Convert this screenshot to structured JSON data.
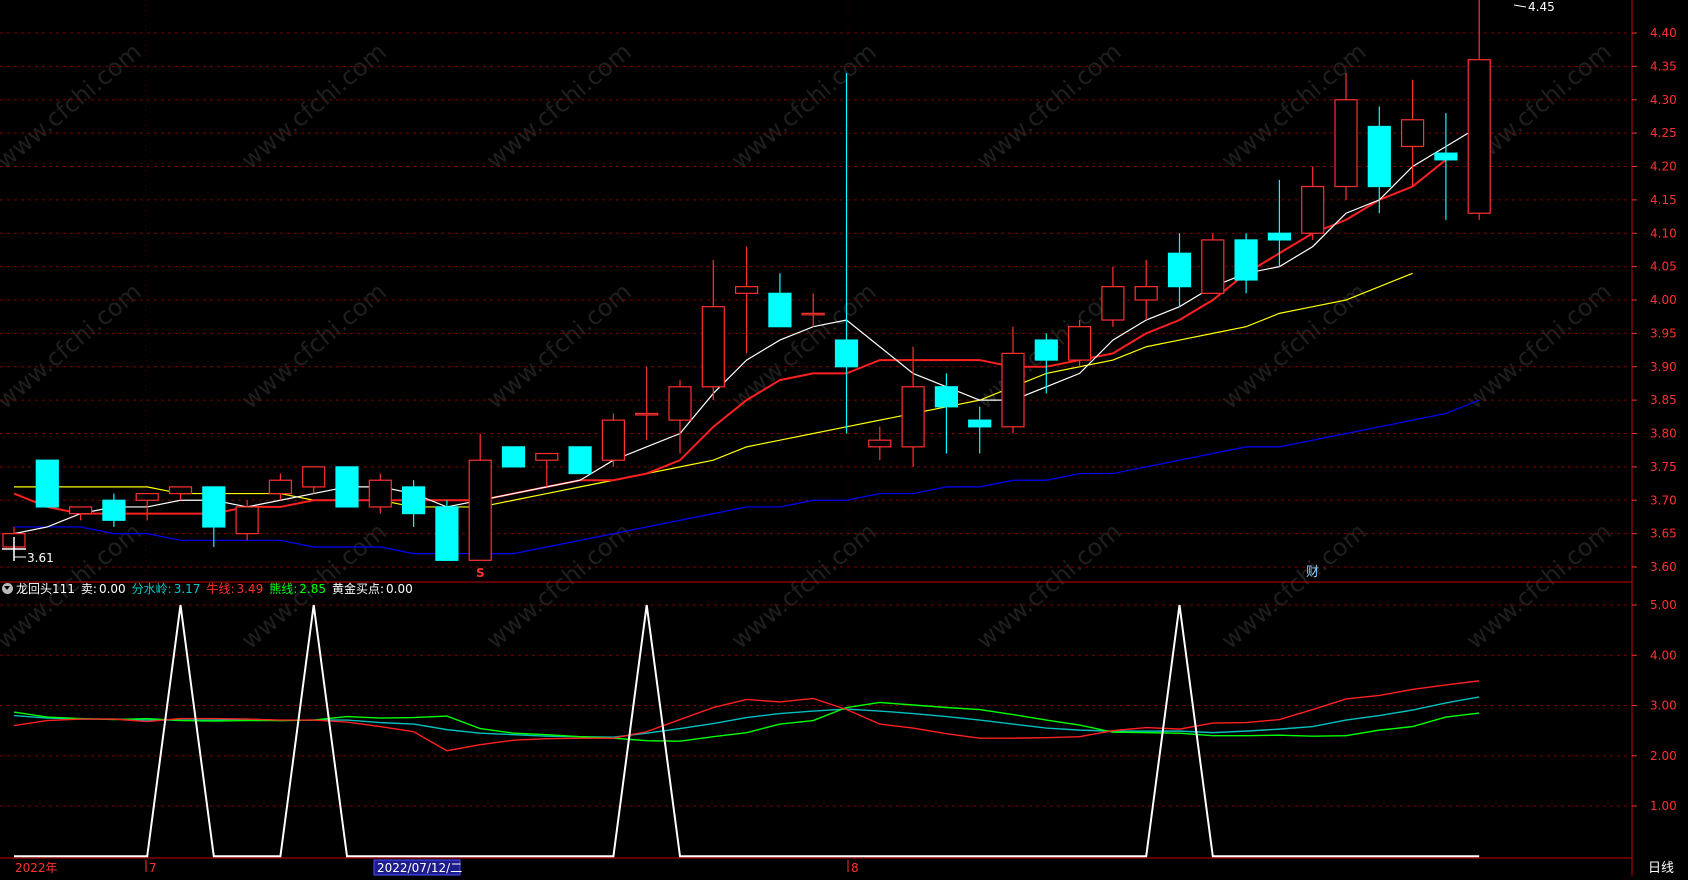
{
  "colors": {
    "background": "#000000",
    "grid": "#7a0000",
    "axis_text": "#ff3030",
    "candle_up": "#ff3030",
    "candle_down": "#00ffff",
    "ma5": "#ffffff",
    "ma10": "#ff2020",
    "ma20": "#ffff00",
    "ma60": "#0000ff",
    "ind_fenshuiling": "#00c0c0",
    "ind_niuxian": "#ff2020",
    "ind_xiongxian": "#00ff00",
    "ind_mai": "#ffffff"
  },
  "top_labels": {
    "high_label": "4.45",
    "low_label": "3.61",
    "marker_s": "S",
    "marker_cai": "财"
  },
  "indicator": {
    "collapse_icon": "chevron-down-icon",
    "name": "龙回头111",
    "mai_label": "卖:",
    "mai_value": "0.00",
    "fenshuiling_label": "分水岭:",
    "fenshuiling_value": "3.17",
    "niuxian_label": "牛线:",
    "niuxian_value": "3.49",
    "xiongxian_label": "熊线:",
    "xiongxian_value": "2.85",
    "huangjin_label": "黄金买点:",
    "huangjin_value": "0.00"
  },
  "bottom_bar": {
    "year": "2022年",
    "month1": "7",
    "cursor_date": "2022/07/12/二",
    "month2": "8",
    "period": "日线"
  },
  "watermark_text": "www.cfchi.com",
  "chart_data": [
    {
      "type": "candlestick",
      "title": "",
      "y_ticks": [
        3.6,
        3.65,
        3.7,
        3.75,
        3.8,
        3.85,
        3.9,
        3.95,
        4.0,
        4.05,
        4.1,
        4.15,
        4.2,
        4.25,
        4.3,
        4.35,
        4.4,
        4.45
      ],
      "ylim": [
        3.585,
        4.455
      ],
      "grid": true,
      "candles": [
        {
          "o": 3.63,
          "h": 3.66,
          "l": 3.62,
          "c": 3.65
        },
        {
          "o": 3.76,
          "h": 3.76,
          "l": 3.69,
          "c": 3.69
        },
        {
          "o": 3.68,
          "h": 3.69,
          "l": 3.67,
          "c": 3.69
        },
        {
          "o": 3.7,
          "h": 3.71,
          "l": 3.66,
          "c": 3.67
        },
        {
          "o": 3.7,
          "h": 3.71,
          "l": 3.67,
          "c": 3.71
        },
        {
          "o": 3.71,
          "h": 3.72,
          "l": 3.7,
          "c": 3.72
        },
        {
          "o": 3.72,
          "h": 3.72,
          "l": 3.63,
          "c": 3.66
        },
        {
          "o": 3.65,
          "h": 3.7,
          "l": 3.64,
          "c": 3.69
        },
        {
          "o": 3.71,
          "h": 3.74,
          "l": 3.7,
          "c": 3.73
        },
        {
          "o": 3.72,
          "h": 3.75,
          "l": 3.71,
          "c": 3.75
        },
        {
          "o": 3.75,
          "h": 3.75,
          "l": 3.69,
          "c": 3.69
        },
        {
          "o": 3.69,
          "h": 3.74,
          "l": 3.68,
          "c": 3.73
        },
        {
          "o": 3.72,
          "h": 3.73,
          "l": 3.66,
          "c": 3.68
        },
        {
          "o": 3.69,
          "h": 3.7,
          "l": 3.61,
          "c": 3.61
        },
        {
          "o": 3.61,
          "h": 3.8,
          "l": 3.61,
          "c": 3.76
        },
        {
          "o": 3.78,
          "h": 3.78,
          "l": 3.75,
          "c": 3.75
        },
        {
          "o": 3.76,
          "h": 3.77,
          "l": 3.72,
          "c": 3.77
        },
        {
          "o": 3.78,
          "h": 3.78,
          "l": 3.74,
          "c": 3.74
        },
        {
          "o": 3.76,
          "h": 3.83,
          "l": 3.75,
          "c": 3.82
        },
        {
          "o": 3.83,
          "h": 3.9,
          "l": 3.79,
          "c": 3.83
        },
        {
          "o": 3.82,
          "h": 3.88,
          "l": 3.77,
          "c": 3.87
        },
        {
          "o": 3.87,
          "h": 4.06,
          "l": 3.85,
          "c": 3.99
        },
        {
          "o": 4.01,
          "h": 4.08,
          "l": 3.92,
          "c": 4.02
        },
        {
          "o": 4.01,
          "h": 4.04,
          "l": 3.96,
          "c": 3.96
        },
        {
          "o": 3.98,
          "h": 4.01,
          "l": 3.96,
          "c": 3.98
        },
        {
          "o": 3.94,
          "h": 4.34,
          "l": 3.8,
          "c": 3.9
        },
        {
          "o": 3.78,
          "h": 3.81,
          "l": 3.76,
          "c": 3.79
        },
        {
          "o": 3.78,
          "h": 3.93,
          "l": 3.75,
          "c": 3.87
        },
        {
          "o": 3.87,
          "h": 3.89,
          "l": 3.77,
          "c": 3.84
        },
        {
          "o": 3.82,
          "h": 3.84,
          "l": 3.77,
          "c": 3.81
        },
        {
          "o": 3.81,
          "h": 3.96,
          "l": 3.8,
          "c": 3.92
        },
        {
          "o": 3.94,
          "h": 3.95,
          "l": 3.86,
          "c": 3.91
        },
        {
          "o": 3.91,
          "h": 3.97,
          "l": 3.9,
          "c": 3.96
        },
        {
          "o": 3.97,
          "h": 4.05,
          "l": 3.96,
          "c": 4.02
        },
        {
          "o": 4.0,
          "h": 4.06,
          "l": 3.97,
          "c": 4.02
        },
        {
          "o": 4.07,
          "h": 4.1,
          "l": 3.99,
          "c": 4.02
        },
        {
          "o": 4.01,
          "h": 4.1,
          "l": 4.01,
          "c": 4.09
        },
        {
          "o": 4.09,
          "h": 4.1,
          "l": 4.01,
          "c": 4.03
        },
        {
          "o": 4.1,
          "h": 4.18,
          "l": 4.05,
          "c": 4.09
        },
        {
          "o": 4.1,
          "h": 4.2,
          "l": 4.09,
          "c": 4.17
        },
        {
          "o": 4.17,
          "h": 4.34,
          "l": 4.15,
          "c": 4.3
        },
        {
          "o": 4.26,
          "h": 4.29,
          "l": 4.13,
          "c": 4.17
        },
        {
          "o": 4.23,
          "h": 4.33,
          "l": 4.17,
          "c": 4.27
        },
        {
          "o": 4.22,
          "h": 4.28,
          "l": 4.12,
          "c": 4.21
        },
        {
          "o": 4.13,
          "h": 4.45,
          "l": 4.12,
          "c": 4.36
        }
      ],
      "moving_averages": {
        "ma5": [
          3.65,
          3.66,
          3.68,
          3.69,
          3.69,
          3.7,
          3.7,
          3.69,
          3.7,
          3.71,
          3.72,
          3.72,
          3.71,
          3.69,
          3.7,
          3.71,
          3.72,
          3.73,
          3.76,
          3.78,
          3.8,
          3.86,
          3.91,
          3.94,
          3.96,
          3.97,
          3.93,
          3.89,
          3.87,
          3.85,
          3.85,
          3.87,
          3.89,
          3.94,
          3.97,
          3.99,
          4.02,
          4.04,
          4.05,
          4.08,
          4.13,
          4.15,
          4.2,
          4.23,
          4.26
        ],
        "ma10": [
          3.71,
          3.69,
          3.68,
          3.68,
          3.68,
          3.68,
          3.68,
          3.69,
          3.69,
          3.7,
          3.7,
          3.7,
          3.7,
          3.7,
          3.7,
          3.71,
          3.72,
          3.73,
          3.73,
          3.74,
          3.76,
          3.81,
          3.85,
          3.88,
          3.89,
          3.89,
          3.91,
          3.91,
          3.91,
          3.91,
          3.9,
          3.9,
          3.91,
          3.92,
          3.95,
          3.97,
          4.0,
          4.04,
          4.07,
          4.1,
          4.12,
          4.15,
          4.17,
          4.21
        ],
        "ma20": [
          3.72,
          3.72,
          3.72,
          3.72,
          3.72,
          3.71,
          3.71,
          3.71,
          3.71,
          3.7,
          3.7,
          3.7,
          3.69,
          3.69,
          3.69,
          3.7,
          3.71,
          3.72,
          3.73,
          3.74,
          3.75,
          3.76,
          3.78,
          3.79,
          3.8,
          3.81,
          3.82,
          3.83,
          3.84,
          3.85,
          3.87,
          3.89,
          3.9,
          3.91,
          3.93,
          3.94,
          3.95,
          3.96,
          3.98,
          3.99,
          4.0,
          4.02,
          4.04
        ],
        "ma60": [
          3.66,
          3.66,
          3.66,
          3.65,
          3.65,
          3.64,
          3.64,
          3.64,
          3.64,
          3.63,
          3.63,
          3.63,
          3.62,
          3.62,
          3.62,
          3.62,
          3.63,
          3.64,
          3.65,
          3.66,
          3.67,
          3.68,
          3.69,
          3.69,
          3.7,
          3.7,
          3.71,
          3.71,
          3.72,
          3.72,
          3.73,
          3.73,
          3.74,
          3.74,
          3.75,
          3.76,
          3.77,
          3.78,
          3.78,
          3.79,
          3.8,
          3.81,
          3.82,
          3.83,
          3.85
        ]
      }
    },
    {
      "type": "line",
      "title": "龙回头111",
      "y_ticks": [
        1.0,
        2.0,
        3.0,
        4.0,
        5.0
      ],
      "ylim": [
        0,
        5.25
      ],
      "grid": true,
      "series": [
        {
          "name": "卖",
          "values": [
            0,
            0,
            0,
            0,
            0,
            5,
            0,
            0,
            0,
            5,
            0,
            0,
            0,
            0,
            0,
            0,
            0,
            0,
            0,
            5,
            0,
            0,
            0,
            0,
            0,
            0,
            0,
            0,
            0,
            0,
            0,
            0,
            0,
            0,
            0,
            5,
            0,
            0,
            0,
            0,
            0,
            0,
            0,
            0,
            0
          ]
        },
        {
          "name": "分水岭",
          "values": [
            2.8,
            2.75,
            2.73,
            2.73,
            2.71,
            2.71,
            2.71,
            2.73,
            2.7,
            2.71,
            2.71,
            2.66,
            2.63,
            2.52,
            2.45,
            2.42,
            2.39,
            2.38,
            2.37,
            2.45,
            2.54,
            2.64,
            2.76,
            2.84,
            2.89,
            2.93,
            2.89,
            2.84,
            2.78,
            2.71,
            2.63,
            2.55,
            2.51,
            2.49,
            2.49,
            2.49,
            2.46,
            2.49,
            2.53,
            2.58,
            2.71,
            2.8,
            2.91,
            3.05,
            3.17
          ]
        },
        {
          "name": "牛线",
          "values": [
            2.6,
            2.7,
            2.73,
            2.73,
            2.68,
            2.74,
            2.74,
            2.73,
            2.71,
            2.71,
            2.67,
            2.58,
            2.48,
            2.1,
            2.22,
            2.31,
            2.34,
            2.35,
            2.35,
            2.48,
            2.72,
            2.96,
            3.12,
            3.07,
            3.14,
            2.92,
            2.63,
            2.55,
            2.44,
            2.35,
            2.35,
            2.36,
            2.38,
            2.5,
            2.56,
            2.53,
            2.65,
            2.66,
            2.72,
            2.92,
            3.13,
            3.2,
            3.32,
            3.41,
            3.49
          ]
        },
        {
          "name": "熊线",
          "values": [
            2.87,
            2.77,
            2.74,
            2.72,
            2.74,
            2.7,
            2.69,
            2.7,
            2.7,
            2.71,
            2.78,
            2.75,
            2.76,
            2.79,
            2.54,
            2.45,
            2.42,
            2.38,
            2.35,
            2.3,
            2.29,
            2.38,
            2.46,
            2.63,
            2.7,
            2.96,
            3.06,
            3.01,
            2.96,
            2.92,
            2.82,
            2.71,
            2.61,
            2.47,
            2.46,
            2.45,
            2.4,
            2.4,
            2.41,
            2.39,
            2.4,
            2.51,
            2.58,
            2.77,
            2.85
          ]
        }
      ]
    }
  ]
}
